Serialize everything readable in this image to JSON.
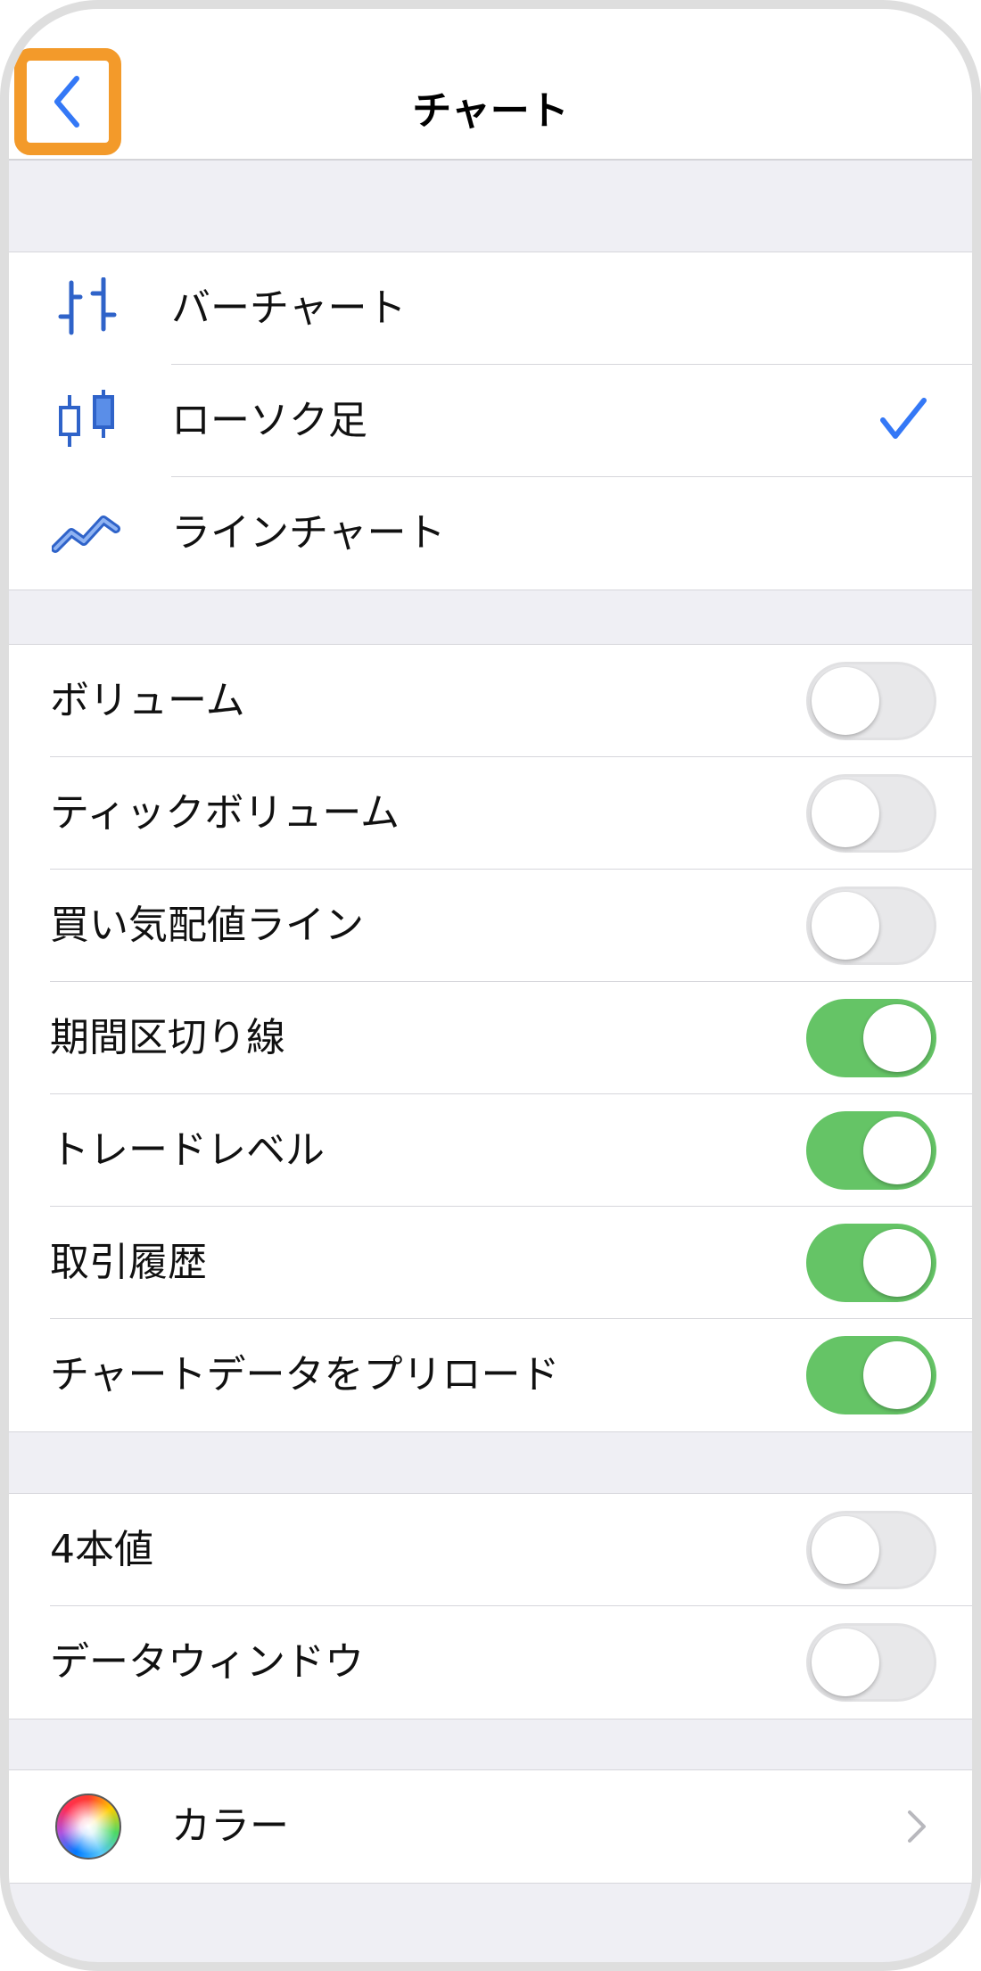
{
  "nav": {
    "title": "チャート",
    "back_icon": "chevron-left-icon"
  },
  "chart_types": [
    {
      "label": "バーチャート",
      "icon": "bar-chart-icon",
      "selected": false
    },
    {
      "label": "ローソク足",
      "icon": "candlestick-icon",
      "selected": true
    },
    {
      "label": "ラインチャート",
      "icon": "line-chart-icon",
      "selected": false
    }
  ],
  "display_settings": [
    {
      "label": "ボリューム",
      "on": false
    },
    {
      "label": "ティックボリューム",
      "on": false
    },
    {
      "label": "買い気配値ライン",
      "on": false
    },
    {
      "label": "期間区切り線",
      "on": true
    },
    {
      "label": "トレードレベル",
      "on": true
    },
    {
      "label": "取引履歴",
      "on": true
    },
    {
      "label": "チャートデータをプリロード",
      "on": true
    }
  ],
  "extra_settings": [
    {
      "label": "4本値",
      "on": false
    },
    {
      "label": "データウィンドウ",
      "on": false
    }
  ],
  "colors": {
    "label": "カラー",
    "icon": "color-wheel-icon"
  },
  "theme": {
    "accent": "#3478f6",
    "toggle_on": "#65c466",
    "highlight": "#f39a2a",
    "group_bg": "#efeff4"
  }
}
